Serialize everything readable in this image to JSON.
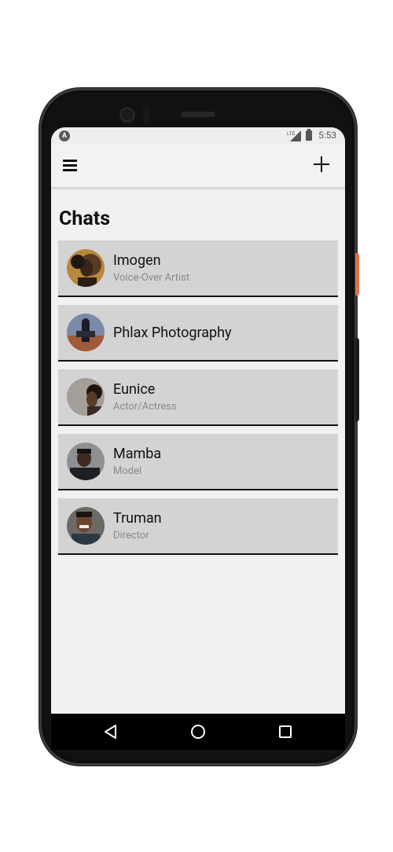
{
  "status_bar": {
    "app_icon": "A",
    "network": "LTE",
    "time": "5:53"
  },
  "app_bar": {
    "menu_icon": "hamburger-menu-icon",
    "add_icon": "plus-icon"
  },
  "page_title": "Chats",
  "chats": [
    {
      "name": "Imogen",
      "subtitle": "Voice-Over Artist"
    },
    {
      "name": "Phlax Photography",
      "subtitle": ""
    },
    {
      "name": "Eunice",
      "subtitle": "Actor/Actress"
    },
    {
      "name": "Mamba",
      "subtitle": "Model"
    },
    {
      "name": "Truman",
      "subtitle": "Director"
    }
  ],
  "nav_bar": {
    "back_icon": "back-triangle-icon",
    "home_icon": "home-circle-icon",
    "recents_icon": "recents-square-icon"
  },
  "colors": {
    "screen_bg": "#f1f1f1",
    "chat_item_bg": "#d3d3d3",
    "accent_button": "#e0704a"
  }
}
